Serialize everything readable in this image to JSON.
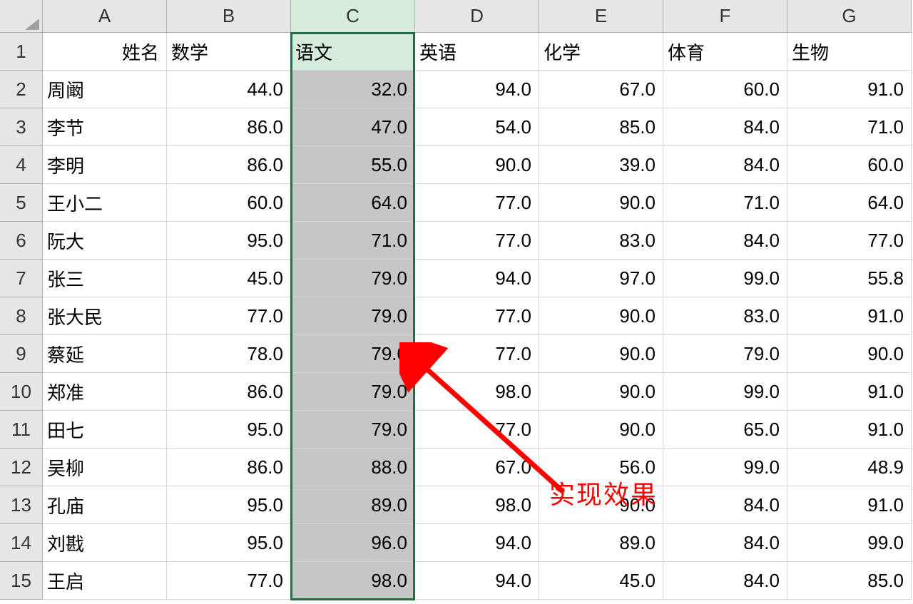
{
  "columns": [
    "A",
    "B",
    "C",
    "D",
    "E",
    "F",
    "G"
  ],
  "selected_column_index": 2,
  "headers": {
    "name": "姓名",
    "subjects": [
      "数学",
      "语文",
      "英语",
      "化学",
      "体育",
      "生物"
    ]
  },
  "rows": [
    {
      "n": 2,
      "name": "周阚",
      "scores": [
        44.0,
        32.0,
        94.0,
        67.0,
        60.0,
        91.0
      ]
    },
    {
      "n": 3,
      "name": "李节",
      "scores": [
        86.0,
        47.0,
        54.0,
        85.0,
        84.0,
        71.0
      ]
    },
    {
      "n": 4,
      "name": "李明",
      "scores": [
        86.0,
        55.0,
        90.0,
        39.0,
        84.0,
        60.0
      ]
    },
    {
      "n": 5,
      "name": "王小二",
      "scores": [
        60.0,
        64.0,
        77.0,
        90.0,
        71.0,
        64.0
      ]
    },
    {
      "n": 6,
      "name": "阮大",
      "scores": [
        95.0,
        71.0,
        77.0,
        83.0,
        84.0,
        77.0
      ]
    },
    {
      "n": 7,
      "name": "张三",
      "scores": [
        45.0,
        79.0,
        94.0,
        97.0,
        99.0,
        55.8
      ]
    },
    {
      "n": 8,
      "name": "张大民",
      "scores": [
        77.0,
        79.0,
        77.0,
        90.0,
        83.0,
        91.0
      ]
    },
    {
      "n": 9,
      "name": "蔡延",
      "scores": [
        78.0,
        79.0,
        77.0,
        90.0,
        79.0,
        90.0
      ]
    },
    {
      "n": 10,
      "name": "郑准",
      "scores": [
        86.0,
        79.0,
        98.0,
        90.0,
        99.0,
        91.0
      ]
    },
    {
      "n": 11,
      "name": "田七",
      "scores": [
        95.0,
        79.0,
        77.0,
        90.0,
        65.0,
        91.0
      ]
    },
    {
      "n": 12,
      "name": "吴柳",
      "scores": [
        86.0,
        88.0,
        67.0,
        56.0,
        99.0,
        48.9
      ]
    },
    {
      "n": 13,
      "name": "孔庙",
      "scores": [
        95.0,
        89.0,
        98.0,
        90.0,
        84.0,
        91.0
      ]
    },
    {
      "n": 14,
      "name": "刘戡",
      "scores": [
        95.0,
        96.0,
        94.0,
        89.0,
        84.0,
        99.0
      ]
    },
    {
      "n": 15,
      "name": "王启",
      "scores": [
        77.0,
        98.0,
        94.0,
        45.0,
        84.0,
        85.0
      ]
    }
  ],
  "annotation_text": "实现效果",
  "colors": {
    "selection_border": "#1e7145",
    "annotation": "#fe0000",
    "selected_fill": "#c6c6c6",
    "header_selected": "#d5ebdb"
  }
}
